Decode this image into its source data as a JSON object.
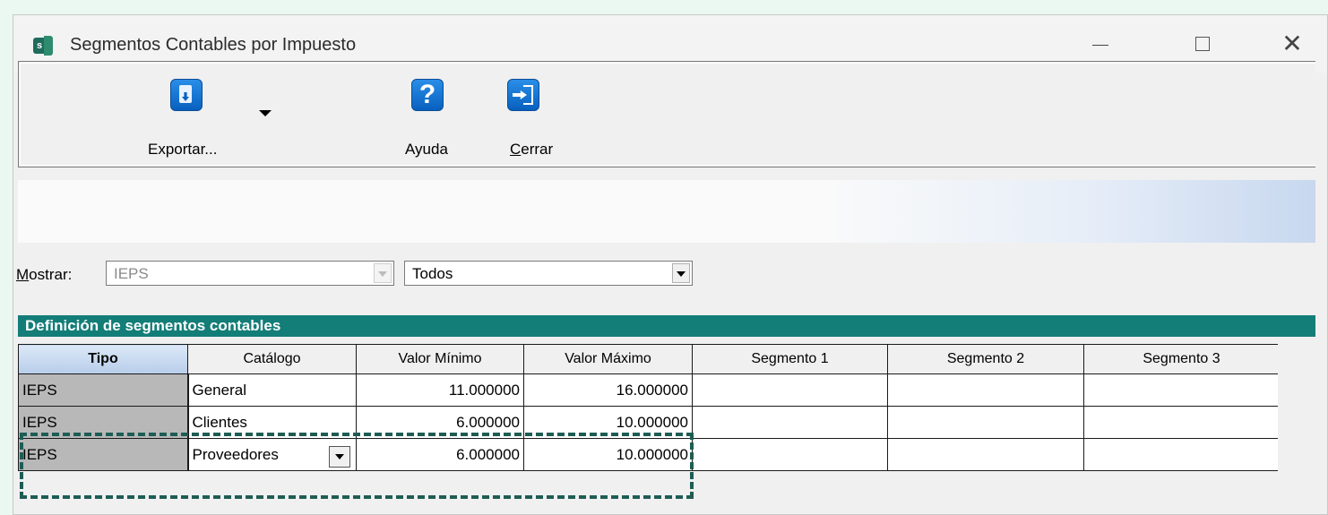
{
  "window": {
    "title": "Segmentos Contables por Impuesto",
    "icon": "app-s-icon"
  },
  "toolbar": {
    "export_label": "Exportar...",
    "help_label": "Ayuda",
    "close_label_first": "C",
    "close_label_rest": "errar"
  },
  "filters": {
    "label_first": "M",
    "label_rest": "ostrar:",
    "impuesto_value": "IEPS",
    "filtro_value": "Todos"
  },
  "grid": {
    "section_title": "Definición de segmentos contables",
    "columns": [
      "Tipo",
      "Catálogo",
      "Valor Mínimo",
      "Valor Máximo",
      "Segmento 1",
      "Segmento 2",
      "Segmento 3"
    ],
    "rows": [
      [
        "IEPS",
        "General",
        "11.000000",
        "16.000000",
        "",
        "",
        ""
      ],
      [
        "IEPS",
        "Clientes",
        "6.000000",
        "10.000000",
        "",
        "",
        ""
      ],
      [
        "IEPS",
        "Proveedores",
        "6.000000",
        "10.000000",
        "",
        "",
        ""
      ]
    ]
  },
  "colors": {
    "section_header": "#137d78",
    "highlight_border": "#1e5d54",
    "icon_blue": "#0860bf"
  }
}
